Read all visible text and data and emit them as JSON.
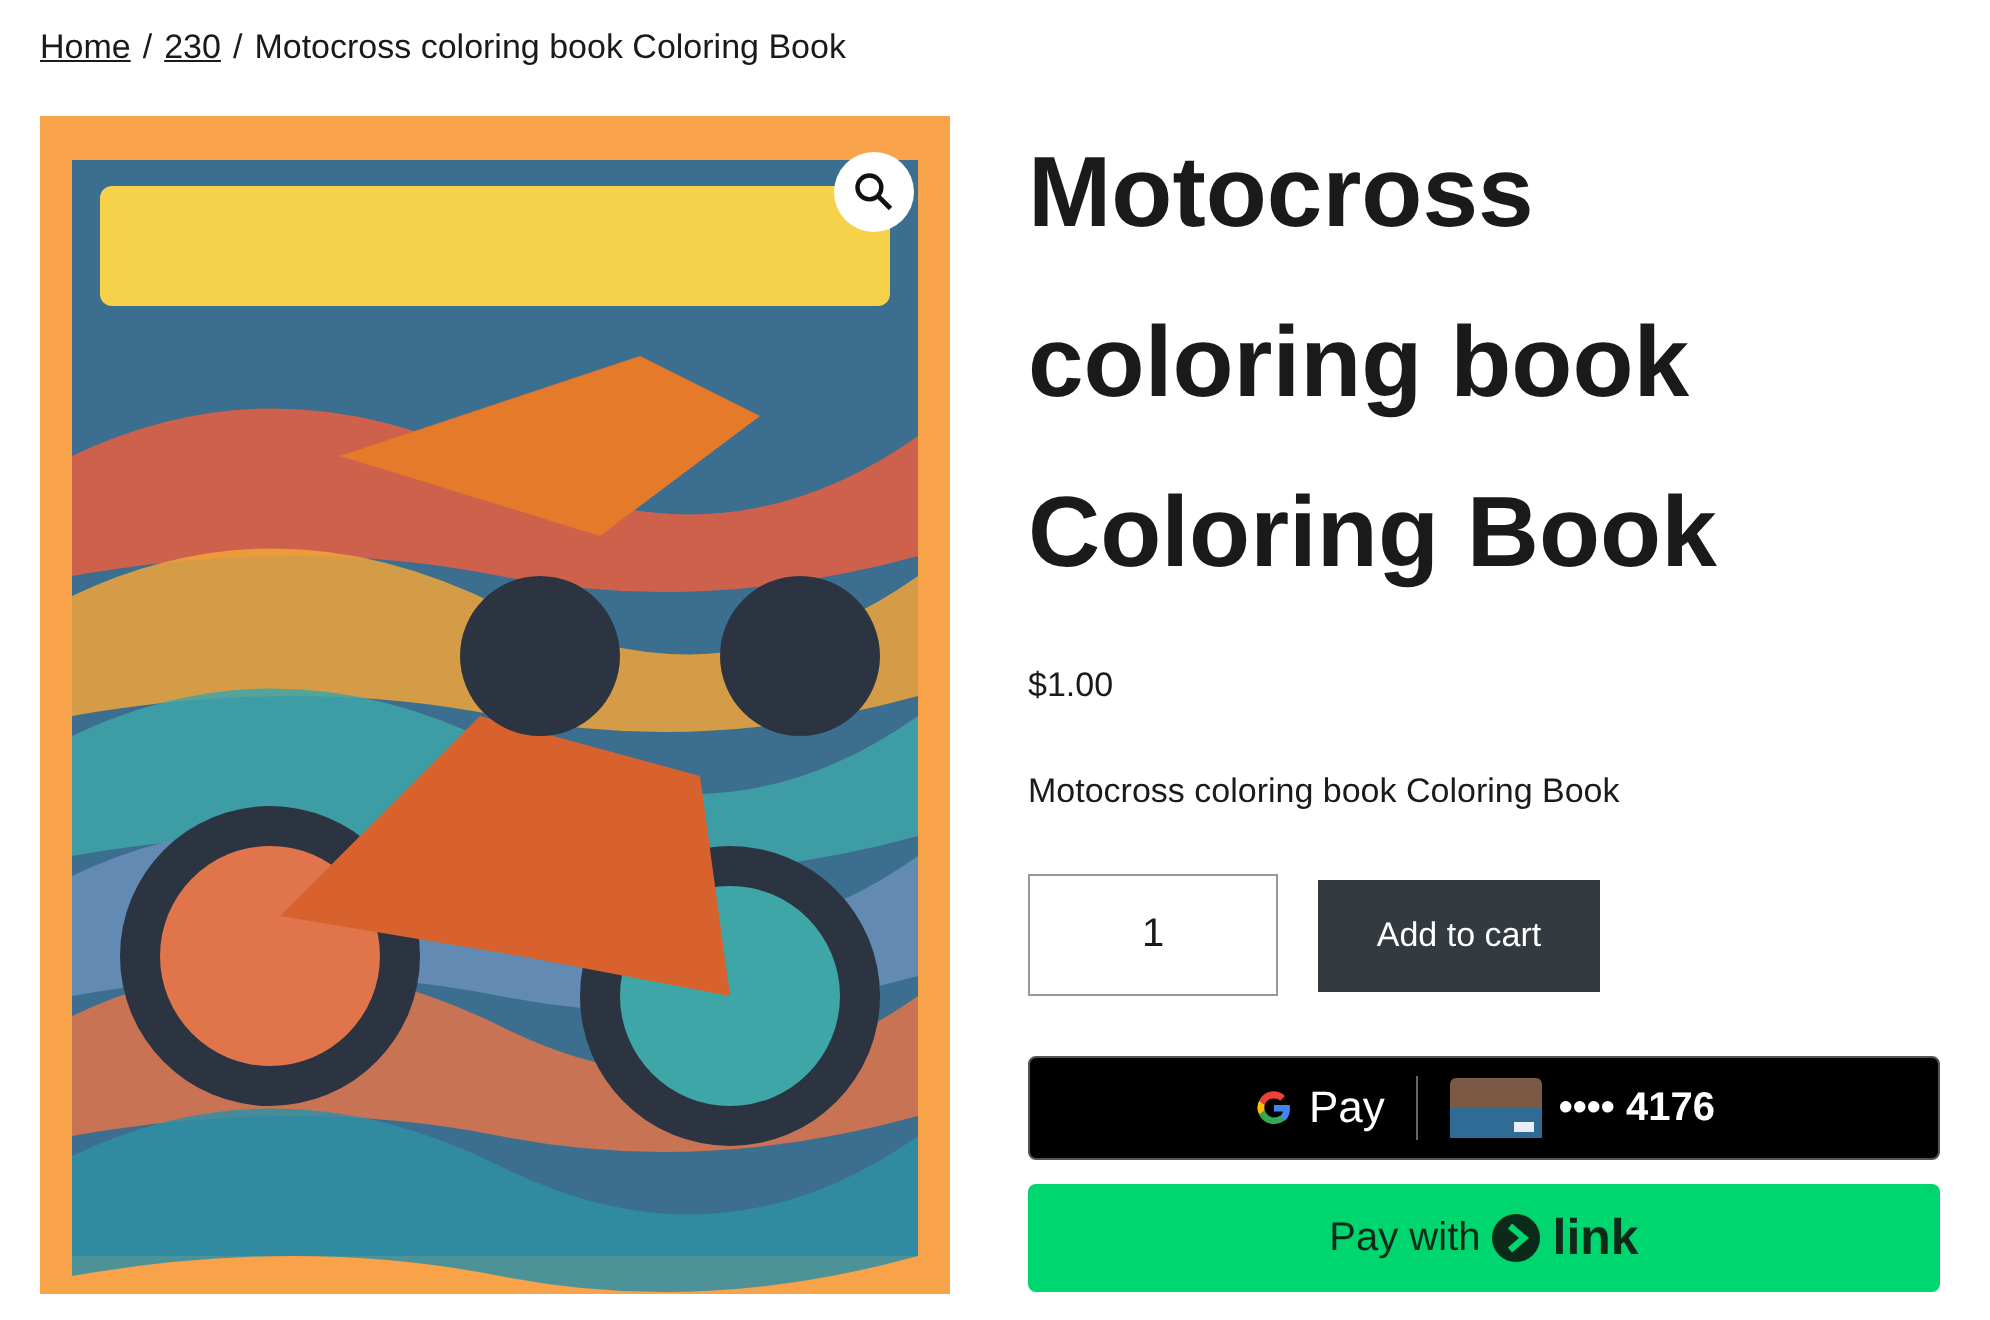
{
  "breadcrumb": {
    "links": [
      "Home",
      "230"
    ],
    "separator": "/",
    "current": "Motocross coloring book Coloring Book"
  },
  "title": "Motocross coloring book Coloring Book",
  "price": "$1.00",
  "description": "Motocross coloring book Coloring Book",
  "quantity": "1",
  "add_to_cart": "Add to cart",
  "google_pay": {
    "label": "Pay",
    "card_number": "•••• 4176"
  },
  "link_pay": {
    "label": "Pay with",
    "brand": "link"
  }
}
